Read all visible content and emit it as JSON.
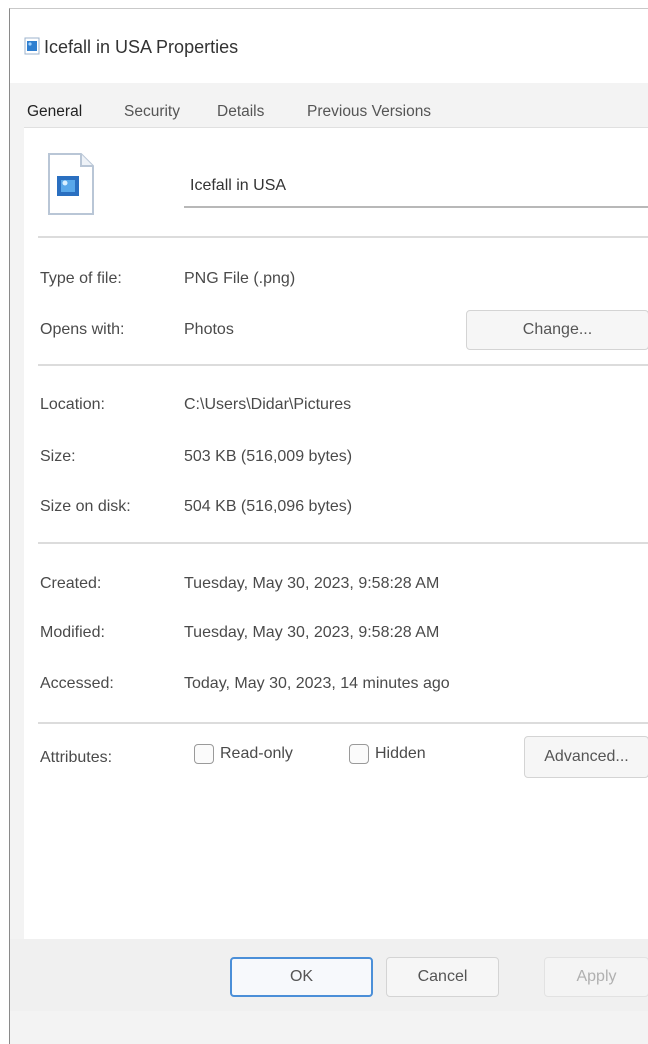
{
  "window": {
    "title": "Icefall in USA Properties",
    "icon": "image-file-icon"
  },
  "tabs": [
    {
      "label": "General",
      "active": true
    },
    {
      "label": "Security",
      "active": false
    },
    {
      "label": "Details",
      "active": false
    },
    {
      "label": "Previous Versions",
      "active": false
    }
  ],
  "general": {
    "file_name": "Icefall in USA",
    "type_label": "Type of file:",
    "type_value": "PNG File (.png)",
    "opens_label": "Opens with:",
    "opens_value": "Photos",
    "change_button": "Change...",
    "location_label": "Location:",
    "location_value": "C:\\Users\\Didar\\Pictures",
    "size_label": "Size:",
    "size_value": "503 KB (516,009 bytes)",
    "size_disk_label": "Size on disk:",
    "size_disk_value": "504 KB (516,096 bytes)",
    "created_label": "Created:",
    "created_value": "Tuesday, May 30, 2023, 9:58:28 AM",
    "modified_label": "Modified:",
    "modified_value": "Tuesday, May 30, 2023, 9:58:28 AM",
    "accessed_label": "Accessed:",
    "accessed_value": "Today, May 30, 2023, 14 minutes ago",
    "attributes_label": "Attributes:",
    "readonly_label": "Read-only",
    "readonly_checked": false,
    "hidden_label": "Hidden",
    "hidden_checked": false,
    "advanced_button": "Advanced..."
  },
  "footer": {
    "ok_label": "OK",
    "cancel_label": "Cancel",
    "apply_label": "Apply"
  },
  "colors": {
    "accent": "#4b8fd8",
    "panel_bg": "#ffffff",
    "window_bg": "#f3f3f3"
  }
}
